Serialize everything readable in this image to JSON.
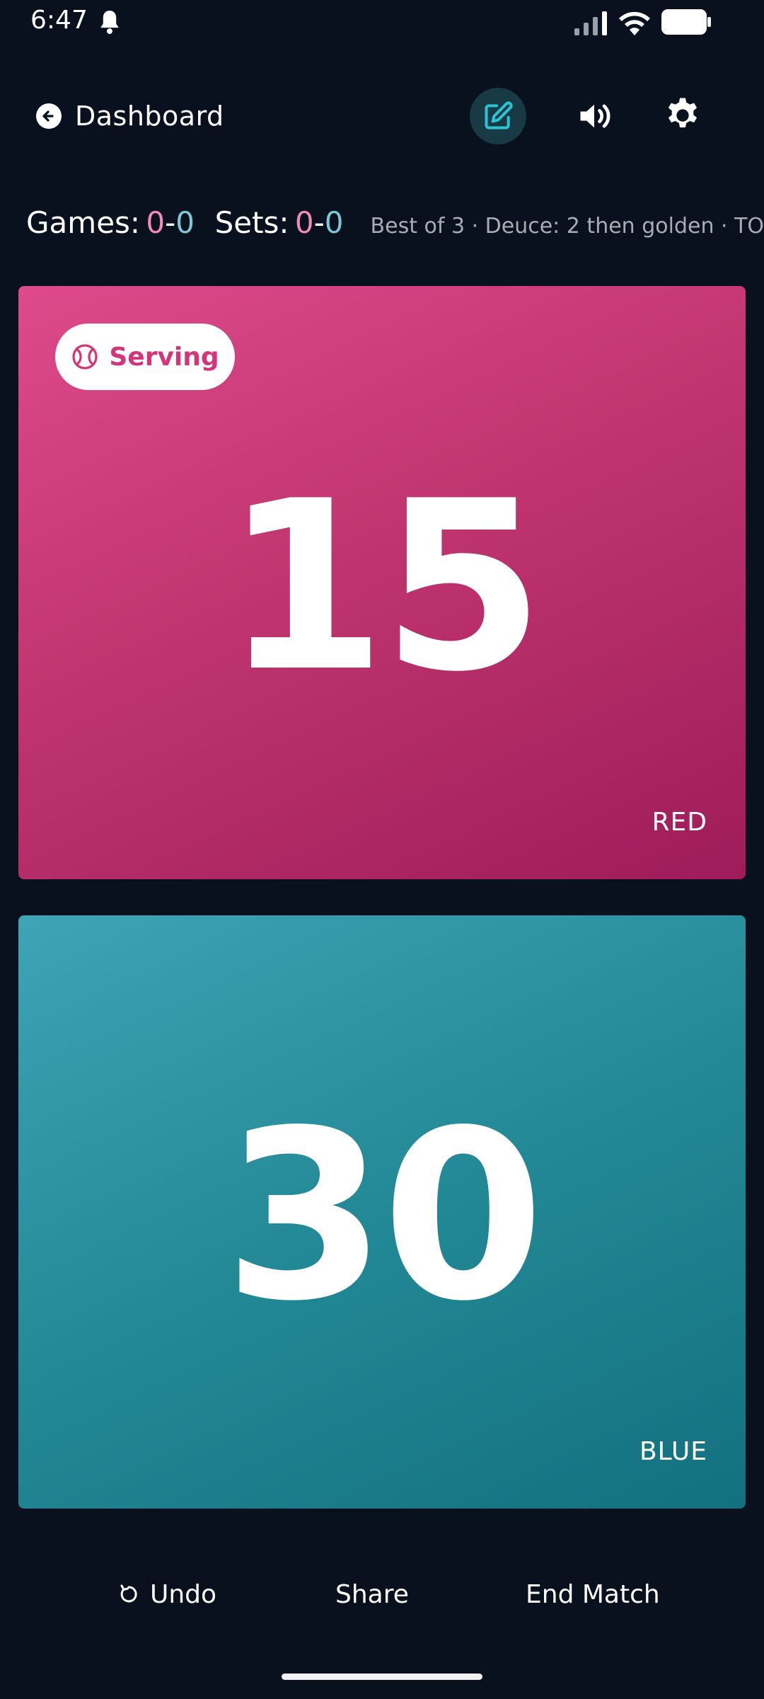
{
  "status_bar": {
    "time": "6:47",
    "icons": [
      "bell-icon",
      "signal-icon",
      "wifi-icon",
      "battery-icon"
    ]
  },
  "header": {
    "back_label": "Dashboard",
    "icons": {
      "back": "arrow-left-circle-icon",
      "edit": "edit-icon",
      "sound": "volume-icon",
      "settings": "gear-icon"
    }
  },
  "summary": {
    "games_label": "Games:",
    "games_red": "0",
    "games_blue": "0",
    "sets_label": "Sets:",
    "sets_red": "0",
    "sets_blue": "0",
    "separator": "-",
    "info": "Best of 3 · Deuce: 2 then golden · TO"
  },
  "teams": {
    "red": {
      "score": "15",
      "name": "RED",
      "serving_label": "Serving",
      "serving": true,
      "color": "#c7357a"
    },
    "blue": {
      "score": "30",
      "name": "BLUE",
      "serving": false,
      "color": "#238996"
    }
  },
  "actions": {
    "undo": "Undo",
    "share": "Share",
    "end_match": "End Match"
  },
  "colors": {
    "background": "#08111d",
    "red_accent": "#f08bb5",
    "blue_accent": "#7cc8d8",
    "edit_bg": "#173a45",
    "edit_icon": "#2bc3d6"
  }
}
